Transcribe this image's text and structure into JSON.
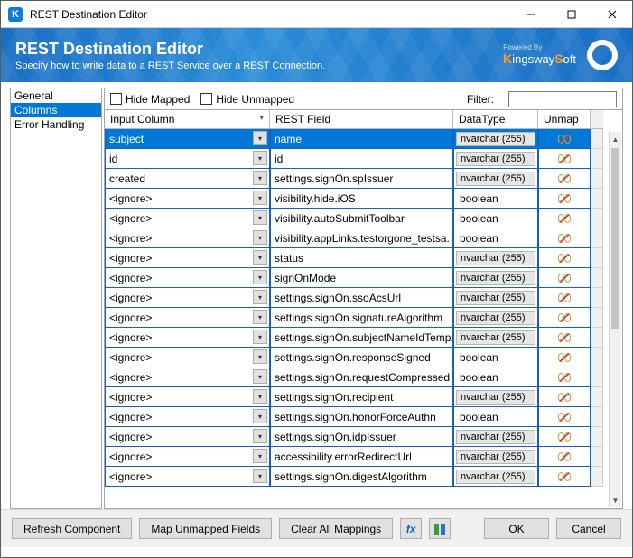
{
  "window": {
    "title": "REST Destination Editor",
    "icon_letter": "K"
  },
  "banner": {
    "title": "REST Destination Editor",
    "subtitle": "Specify how to write data to a REST Service over a REST Connection.",
    "powered": "Powered By",
    "brand": "KingswaySoft"
  },
  "sidebar": {
    "items": [
      {
        "label": "General",
        "selected": false
      },
      {
        "label": "Columns",
        "selected": true
      },
      {
        "label": "Error Handling",
        "selected": false
      }
    ]
  },
  "toolbar": {
    "hide_mapped": "Hide Mapped",
    "hide_unmapped": "Hide Unmapped",
    "filter_label": "Filter:",
    "filter_value": ""
  },
  "grid": {
    "headers": {
      "input": "Input Column",
      "rest": "REST Field",
      "datatype": "DataType",
      "unmap": "Unmap"
    },
    "rows": [
      {
        "input": "subject",
        "rest": "name",
        "dt": "nvarchar (255)",
        "selected": true
      },
      {
        "input": "id",
        "rest": "id",
        "dt": "nvarchar (255)"
      },
      {
        "input": "created",
        "rest": "settings.signOn.spIssuer",
        "dt": "nvarchar (255)"
      },
      {
        "input": "<ignore>",
        "rest": "visibility.hide.iOS",
        "dt": "boolean",
        "dt_plain": true
      },
      {
        "input": "<ignore>",
        "rest": "visibility.autoSubmitToolbar",
        "dt": "boolean",
        "dt_plain": true
      },
      {
        "input": "<ignore>",
        "rest": "visibility.appLinks.testorgone_testsa...",
        "dt": "boolean",
        "dt_plain": true
      },
      {
        "input": "<ignore>",
        "rest": "status",
        "dt": "nvarchar (255)"
      },
      {
        "input": "<ignore>",
        "rest": "signOnMode",
        "dt": "nvarchar (255)"
      },
      {
        "input": "<ignore>",
        "rest": "settings.signOn.ssoAcsUrl",
        "dt": "nvarchar (255)"
      },
      {
        "input": "<ignore>",
        "rest": "settings.signOn.signatureAlgorithm",
        "dt": "nvarchar (255)"
      },
      {
        "input": "<ignore>",
        "rest": "settings.signOn.subjectNameIdTemp...",
        "dt": "nvarchar (255)"
      },
      {
        "input": "<ignore>",
        "rest": "settings.signOn.responseSigned",
        "dt": "boolean",
        "dt_plain": true
      },
      {
        "input": "<ignore>",
        "rest": "settings.signOn.requestCompressed",
        "dt": "boolean",
        "dt_plain": true
      },
      {
        "input": "<ignore>",
        "rest": "settings.signOn.recipient",
        "dt": "nvarchar (255)"
      },
      {
        "input": "<ignore>",
        "rest": "settings.signOn.honorForceAuthn",
        "dt": "boolean",
        "dt_plain": true
      },
      {
        "input": "<ignore>",
        "rest": "settings.signOn.idpIssuer",
        "dt": "nvarchar (255)"
      },
      {
        "input": "<ignore>",
        "rest": "accessibility.errorRedirectUrl",
        "dt": "nvarchar (255)"
      },
      {
        "input": "<ignore>",
        "rest": "settings.signOn.digestAlgorithm",
        "dt": "nvarchar (255)"
      }
    ]
  },
  "footer": {
    "refresh": "Refresh Component",
    "map_unmapped": "Map Unmapped Fields",
    "clear": "Clear All Mappings",
    "ok": "OK",
    "cancel": "Cancel"
  }
}
